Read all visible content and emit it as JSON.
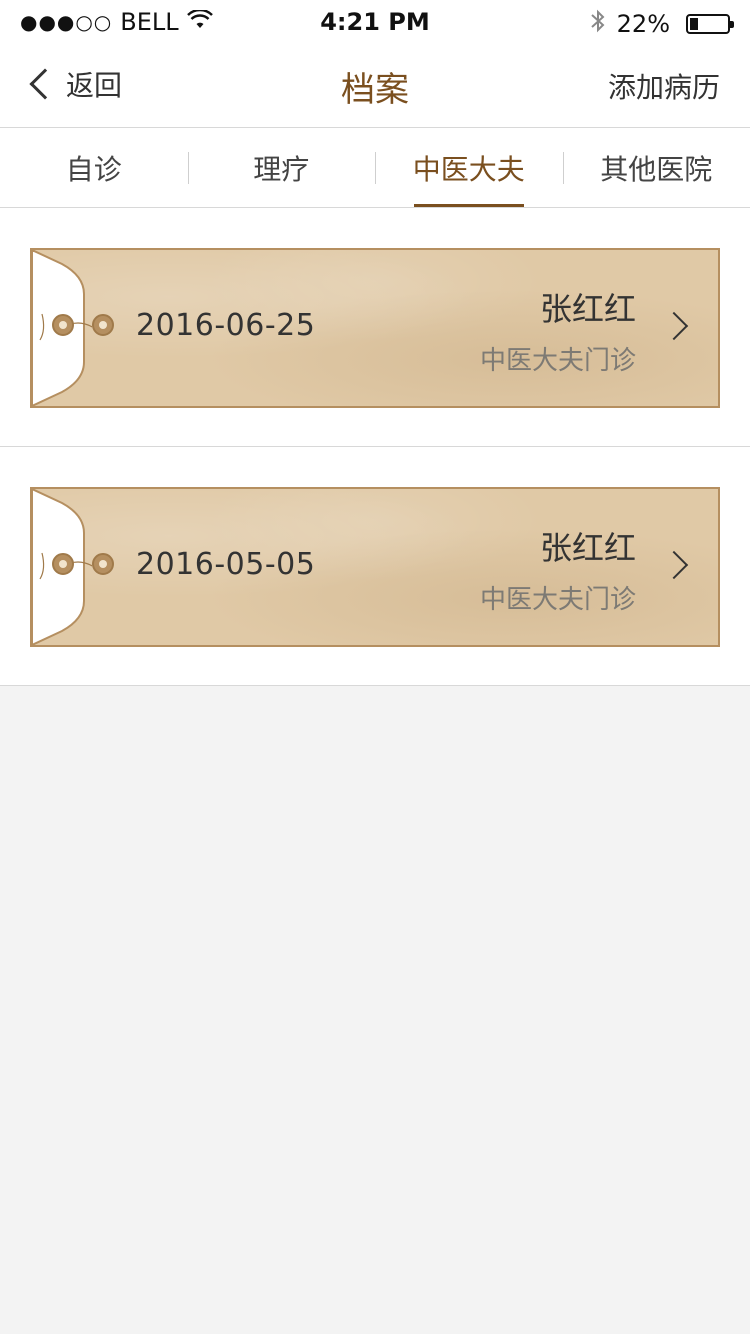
{
  "status_bar": {
    "signal": "●●●○○",
    "carrier": "BELL",
    "time": "4:21 PM",
    "battery_percent": "22%",
    "battery_level": 0.22
  },
  "nav": {
    "back_label": "返回",
    "title": "档案",
    "action_label": "添加病历"
  },
  "tabs": [
    {
      "label": "自诊",
      "active": false
    },
    {
      "label": "理疗",
      "active": false
    },
    {
      "label": "中医大夫",
      "active": true
    },
    {
      "label": "其他医院",
      "active": false
    }
  ],
  "records": [
    {
      "date": "2016-06-25",
      "name": "张红红",
      "type": "中医大夫门诊"
    },
    {
      "date": "2016-05-05",
      "name": "张红红",
      "type": "中医大夫门诊"
    }
  ],
  "colors": {
    "accent": "#7a4f1f",
    "card_bg": "#e0c9a6",
    "card_border": "#b58f60",
    "page_bg": "#f3f3f3"
  }
}
